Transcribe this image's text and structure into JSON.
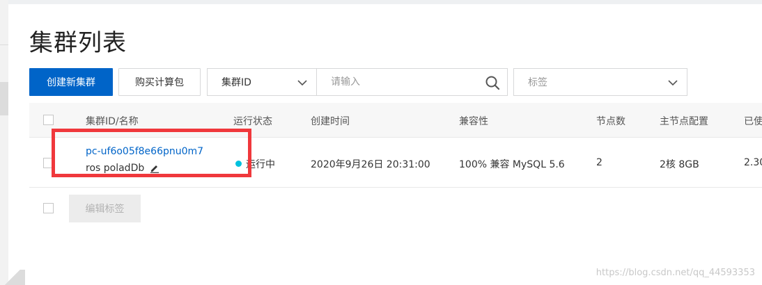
{
  "page": {
    "title": "集群列表"
  },
  "toolbar": {
    "create_label": "创建新集群",
    "buy_label": "购买计算包",
    "field_select": "集群ID",
    "search_placeholder": "请输入",
    "tag_select": "标签"
  },
  "table": {
    "headers": [
      "集群ID/名称",
      "运行状态",
      "创建时间",
      "兼容性",
      "节点数",
      "主节点配置",
      "已使"
    ],
    "rows": [
      {
        "id": "pc-uf6o05f8e66pnu0m7",
        "name": "ros poladDb",
        "status": "运行中",
        "created": "2020年9月26日 20:31:00",
        "compat": "100% 兼容 MySQL 5.6",
        "nodes": "2",
        "spec": "2核 8GB",
        "used": "2.30"
      }
    ]
  },
  "footer": {
    "edit_tags_label": "编辑标签"
  },
  "watermark": "https://blog.csdn.net/qq_44593353",
  "colors": {
    "primary": "#0064c8",
    "status_running": "#00c1de",
    "highlight": "#f0383c"
  }
}
